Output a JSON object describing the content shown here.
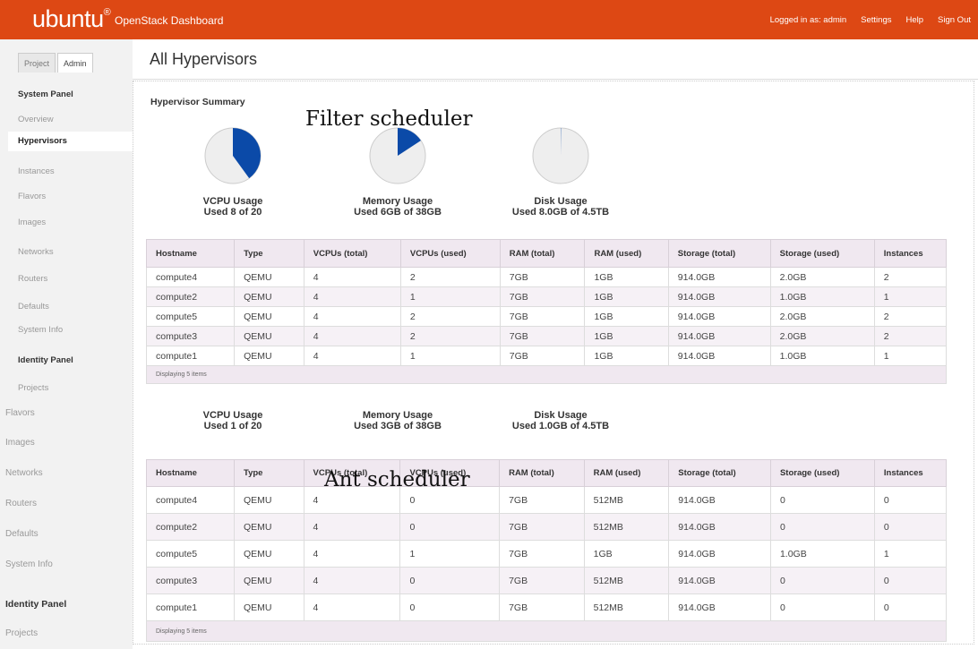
{
  "header": {
    "logo": "ubuntu",
    "logo_mark": "®",
    "title": "OpenStack Dashboard",
    "nav": [
      "Logged in as: admin",
      "Settings",
      "Help",
      "Sign Out"
    ],
    "brand_color": "#dd4814"
  },
  "sidebar": {
    "tabs": [
      "Project",
      "Admin"
    ],
    "active_tab": "Admin",
    "items_top": [
      {
        "label": "System Panel",
        "kind": "heading"
      },
      {
        "label": "Overview"
      },
      {
        "label": "Hypervisors",
        "selected": true
      },
      {
        "label": "Instances"
      },
      {
        "label": "Flavors"
      },
      {
        "label": "Images"
      },
      {
        "label": "Networks"
      },
      {
        "label": "Routers"
      },
      {
        "label": "Defaults"
      },
      {
        "label": "System Info"
      },
      {
        "label": "Identity Panel",
        "kind": "heading"
      },
      {
        "label": "Projects"
      }
    ],
    "items_bottom": [
      {
        "label": "Flavors"
      },
      {
        "label": "Images"
      },
      {
        "label": "Networks"
      },
      {
        "label": "Routers"
      },
      {
        "label": "Defaults"
      },
      {
        "label": "System Info"
      },
      {
        "label": "Identity Panel",
        "kind": "heading"
      },
      {
        "label": "Projects"
      }
    ]
  },
  "main": {
    "title": "All Hypervisors",
    "summary_heading": "Hypervisor Summary",
    "overlay_top": "Filter scheduler",
    "overlay_bottom": "Ant scheduler",
    "summary_top": [
      {
        "title": "VCPU Usage",
        "detail": "Used 8 of 20",
        "used": 8,
        "total": 20
      },
      {
        "title": "Memory Usage",
        "detail": "Used 6GB of 38GB",
        "used": 6,
        "total": 38
      },
      {
        "title": "Disk Usage",
        "detail": "Used 8.0GB of 4.5TB",
        "used": 8,
        "total": 4608
      }
    ],
    "summary_bottom": [
      {
        "title": "VCPU Usage",
        "detail": "Used 1 of 20"
      },
      {
        "title": "Memory Usage",
        "detail": "Used 3GB of 38GB"
      },
      {
        "title": "Disk Usage",
        "detail": "Used 1.0GB of 4.5TB"
      }
    ],
    "columns": [
      "Hostname",
      "Type",
      "VCPUs (total)",
      "VCPUs (used)",
      "RAM (total)",
      "RAM (used)",
      "Storage (total)",
      "Storage (used)",
      "Instances"
    ],
    "table_top": [
      [
        "compute4",
        "QEMU",
        "4",
        "2",
        "7GB",
        "1GB",
        "914.0GB",
        "2.0GB",
        "2"
      ],
      [
        "compute2",
        "QEMU",
        "4",
        "1",
        "7GB",
        "1GB",
        "914.0GB",
        "1.0GB",
        "1"
      ],
      [
        "compute5",
        "QEMU",
        "4",
        "2",
        "7GB",
        "1GB",
        "914.0GB",
        "2.0GB",
        "2"
      ],
      [
        "compute3",
        "QEMU",
        "4",
        "2",
        "7GB",
        "1GB",
        "914.0GB",
        "2.0GB",
        "2"
      ],
      [
        "compute1",
        "QEMU",
        "4",
        "1",
        "7GB",
        "1GB",
        "914.0GB",
        "1.0GB",
        "1"
      ]
    ],
    "table_bottom": [
      [
        "compute4",
        "QEMU",
        "4",
        "0",
        "7GB",
        "512MB",
        "914.0GB",
        "0",
        "0"
      ],
      [
        "compute2",
        "QEMU",
        "4",
        "0",
        "7GB",
        "512MB",
        "914.0GB",
        "0",
        "0"
      ],
      [
        "compute5",
        "QEMU",
        "4",
        "1",
        "7GB",
        "1GB",
        "914.0GB",
        "1.0GB",
        "1"
      ],
      [
        "compute3",
        "QEMU",
        "4",
        "0",
        "7GB",
        "512MB",
        "914.0GB",
        "0",
        "0"
      ],
      [
        "compute1",
        "QEMU",
        "4",
        "0",
        "7GB",
        "512MB",
        "914.0GB",
        "0",
        "0"
      ]
    ],
    "footer_text": "Displaying 5 items",
    "pie_fill_color": "#0b4aa8",
    "pie_bg_color": "#eeeeee"
  }
}
